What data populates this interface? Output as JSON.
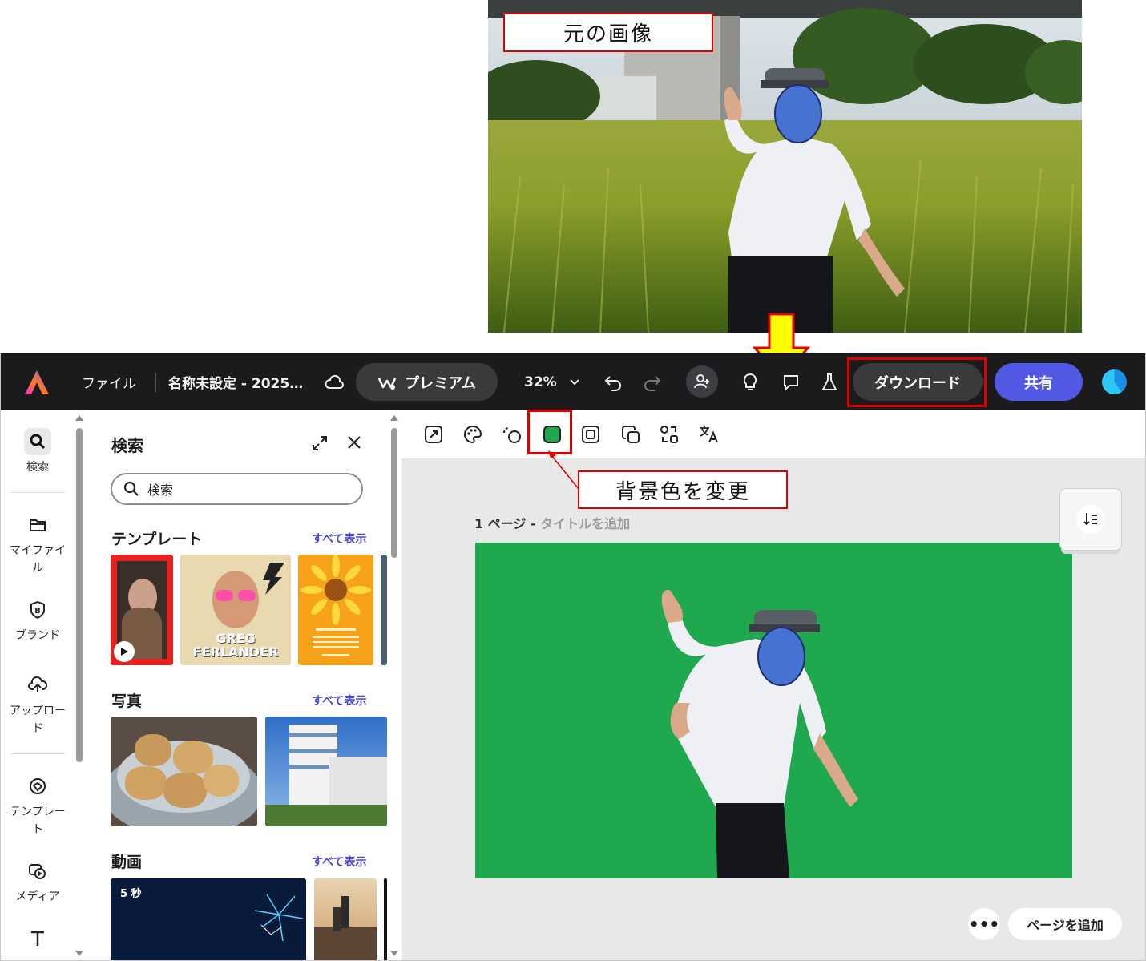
{
  "annotations": {
    "original_label": "元の画像",
    "bg_change_label": "背景色を変更"
  },
  "colors": {
    "accent": "#5258e4",
    "annotation_red": "#e00000",
    "canvas_bg_green": "#1fa84d",
    "topbar": "#1b1b1e"
  },
  "topbar": {
    "file_menu": "ファイル",
    "document_title": "名称未設定 - 2025…",
    "premium_label": "プレミアム",
    "zoom": "32%",
    "download_label": "ダウンロード",
    "share_label": "共有",
    "icons": [
      "adobe-express-logo-icon",
      "cloud-icon",
      "chevron-down-icon",
      "undo-icon",
      "redo-icon",
      "invite-user-icon",
      "lightbulb-icon",
      "comment-icon",
      "flask-icon"
    ]
  },
  "rail": {
    "items": [
      {
        "label": "検索",
        "icon": "search-icon"
      },
      {
        "label": "マイファイル",
        "icon": "folder-icon"
      },
      {
        "label": "ブランド",
        "icon": "brand-icon"
      },
      {
        "label": "アップロード",
        "icon": "upload-icon"
      },
      {
        "label": "テンプレート",
        "icon": "template-icon"
      },
      {
        "label": "メディア",
        "icon": "media-icon"
      },
      {
        "label": "",
        "icon": "text-icon"
      }
    ]
  },
  "panel": {
    "title": "検索",
    "search_placeholder": "検索",
    "sections": [
      {
        "title": "テンプレート",
        "see_all": "すべて表示"
      },
      {
        "title": "写真",
        "see_all": "すべて表示"
      },
      {
        "title": "動画",
        "see_all": "すべて表示"
      }
    ],
    "template_card_text": "GREG FERLANDER",
    "video_duration": "5 秒"
  },
  "canvas": {
    "page_label": "1 ページ - ",
    "page_title_placeholder": "タイトルを追加",
    "add_page": "ページを追加",
    "more": "•••"
  },
  "context_toolbar": {
    "icons": [
      "resize-icon",
      "palette-icon",
      "remove-background-icon",
      "background-color-icon",
      "frame-icon",
      "layers-icon",
      "replace-icon",
      "translate-icon"
    ]
  }
}
